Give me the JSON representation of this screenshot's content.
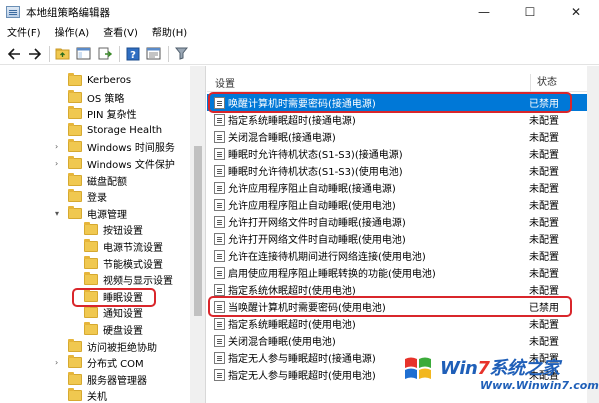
{
  "window": {
    "title": "本地组策略编辑器",
    "controls": {
      "minimize": "—",
      "maximize": "☐",
      "close": "✕"
    }
  },
  "menu": [
    {
      "label": "文件(F)"
    },
    {
      "label": "操作(A)"
    },
    {
      "label": "查看(V)"
    },
    {
      "label": "帮助(H)"
    }
  ],
  "toolbar": {
    "buttons": [
      "back-arrow-icon",
      "forward-arrow-icon",
      "up-folder-icon",
      "show-tree-icon",
      "export-list-icon",
      "help-icon",
      "properties-icon",
      "filter-icon"
    ]
  },
  "tree": {
    "items": [
      {
        "label": "Kerberos",
        "expanded": false
      },
      {
        "label": "OS 策略",
        "expanded": false
      },
      {
        "label": "PIN 复杂性",
        "expanded": false
      },
      {
        "label": "Storage Health",
        "expanded": false
      },
      {
        "label": "Windows 时间服务",
        "expanded": false,
        "has_children": true
      },
      {
        "label": "Windows 文件保护",
        "expanded": false,
        "has_children": true
      },
      {
        "label": "磁盘配额",
        "expanded": false
      },
      {
        "label": "登录",
        "expanded": false
      },
      {
        "label": "电源管理",
        "expanded": true,
        "has_children": true
      },
      {
        "label": "按钮设置",
        "expanded": false
      },
      {
        "label": "电源节流设置",
        "expanded": false
      },
      {
        "label": "节能模式设置",
        "expanded": false
      },
      {
        "label": "视频与显示设置",
        "expanded": false
      },
      {
        "label": "睡眠设置",
        "expanded": false,
        "selected": true
      },
      {
        "label": "通知设置",
        "expanded": false
      },
      {
        "label": "硬盘设置",
        "expanded": false
      },
      {
        "label": "访问被拒绝协助",
        "expanded": false
      },
      {
        "label": "分布式 COM",
        "expanded": false,
        "has_children": true
      },
      {
        "label": "服务器管理器",
        "expanded": false
      },
      {
        "label": "关机",
        "expanded": false
      }
    ]
  },
  "list": {
    "col_setting": "设置",
    "col_state": "状态",
    "rows": [
      {
        "label": "唤醒计算机时需要密码(接通电源)",
        "state": "已禁用",
        "selected": true,
        "boxed": true
      },
      {
        "label": "指定系统睡眠超时(接通电源)",
        "state": "未配置"
      },
      {
        "label": "关闭混合睡眠(接通电源)",
        "state": "未配置"
      },
      {
        "label": "睡眠时允许待机状态(S1-S3)(接通电源)",
        "state": "未配置"
      },
      {
        "label": "睡眠时允许待机状态(S1-S3)(使用电池)",
        "state": "未配置"
      },
      {
        "label": "允许应用程序阻止自动睡眠(接通电源)",
        "state": "未配置"
      },
      {
        "label": "允许应用程序阻止自动睡眠(使用电池)",
        "state": "未配置"
      },
      {
        "label": "允许打开网络文件时自动睡眠(接通电源)",
        "state": "未配置"
      },
      {
        "label": "允许打开网络文件时自动睡眠(使用电池)",
        "state": "未配置"
      },
      {
        "label": "允许在连接待机期间进行网络连接(使用电池)",
        "state": "未配置"
      },
      {
        "label": "启用使应用程序阻止睡眠转换的功能(使用电池)",
        "state": "未配置"
      },
      {
        "label": "指定系统休眠超时(使用电池)",
        "state": "未配置"
      },
      {
        "label": "当唤醒计算机时需要密码(使用电池)",
        "state": "已禁用",
        "boxed": true
      },
      {
        "label": "指定系统睡眠超时(使用电池)",
        "state": "未配置"
      },
      {
        "label": "关闭混合睡眠(使用电池)",
        "state": "未配置"
      },
      {
        "label": "指定无人参与睡眠超时(接通电源)",
        "state": "未配置"
      },
      {
        "label": "指定无人参与睡眠超时(使用电池)",
        "state": "未配置"
      }
    ]
  },
  "watermark": {
    "brand_prefix": "Win",
    "brand_num": "7",
    "brand_suffix": "系统之家",
    "url": "Www.Winwin7.com"
  },
  "colors": {
    "selection": "#0078d7",
    "highlight_box": "#d9262b",
    "folder": "#f0c850"
  }
}
